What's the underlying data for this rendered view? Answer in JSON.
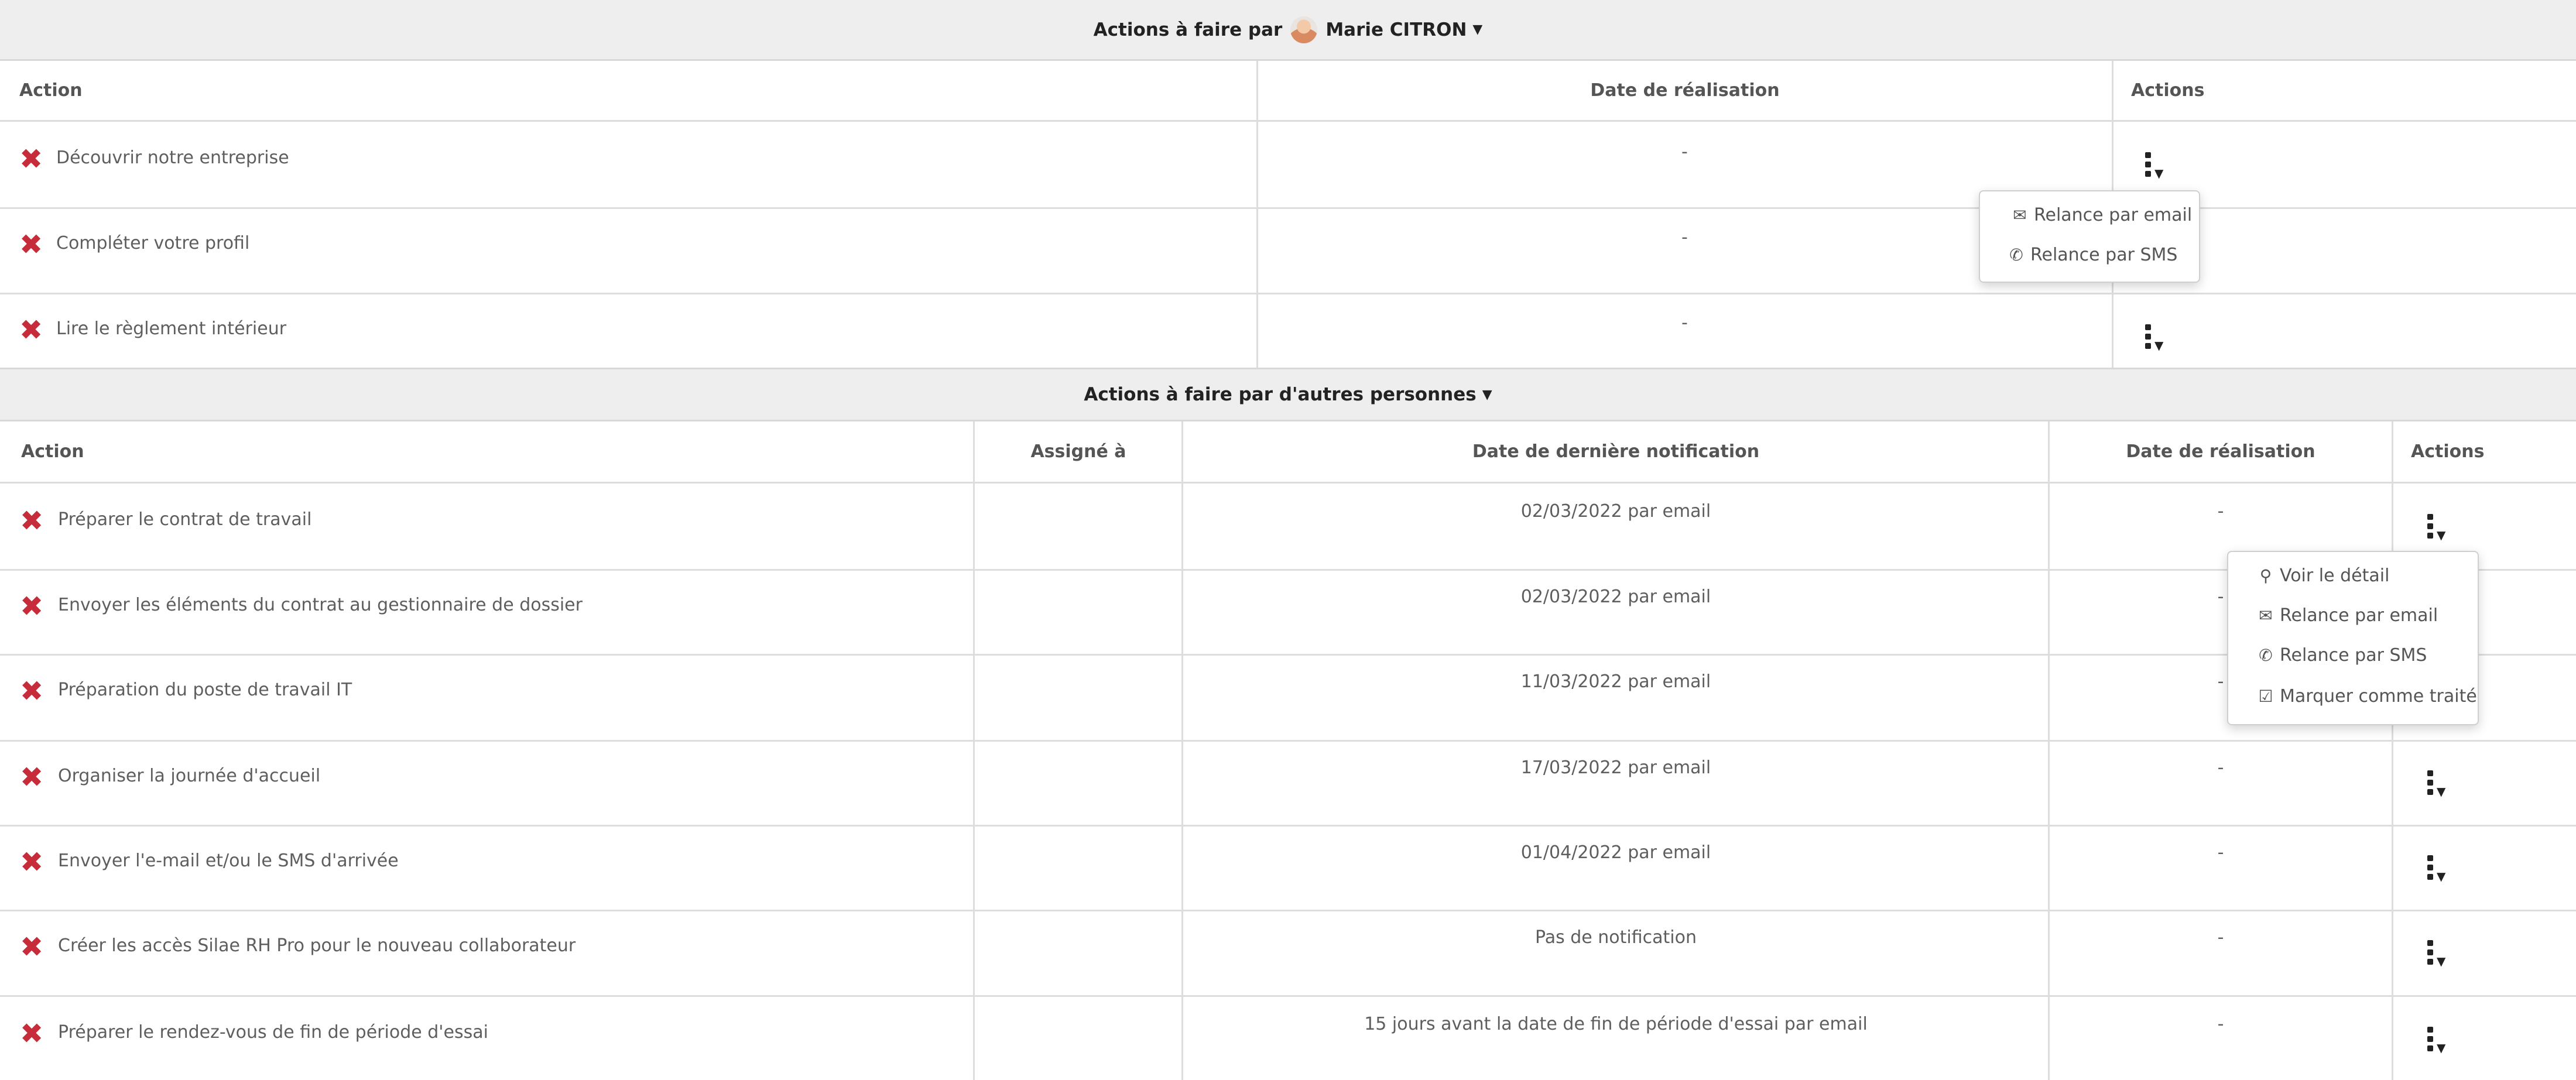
{
  "section1": {
    "title": "Actions à faire par",
    "user": "Marie CITRON",
    "headers": {
      "action": "Action",
      "date": "Date de réalisation",
      "actions": "Actions"
    },
    "rows": [
      {
        "action": "Découvrir notre entreprise",
        "date": "-"
      },
      {
        "action": "Compléter votre profil",
        "date": "-"
      },
      {
        "action": "Lire le règlement intérieur",
        "date": "-"
      }
    ],
    "menu": {
      "email": "Relance par email",
      "sms": "Relance par SMS"
    }
  },
  "section2": {
    "title": "Actions à faire par d'autres personnes",
    "headers": {
      "action": "Action",
      "assigned": "Assigné à",
      "notif": "Date de dernière notification",
      "date": "Date de réalisation",
      "actions": "Actions"
    },
    "rows": [
      {
        "action": "Préparer le contrat de travail",
        "assigned": "",
        "notif": "02/03/2022 par email",
        "date": "-"
      },
      {
        "action": "Envoyer les éléments du contrat au gestionnaire de dossier",
        "assigned": "",
        "notif": "02/03/2022 par email",
        "date": "-"
      },
      {
        "action": "Préparation du poste de travail IT",
        "assigned": "",
        "notif": "11/03/2022 par email",
        "date": "-"
      },
      {
        "action": "Organiser la journée d'accueil",
        "assigned": "",
        "notif": "17/03/2022 par email",
        "date": "-"
      },
      {
        "action": "Envoyer l'e-mail et/ou le SMS d'arrivée",
        "assigned": "",
        "notif": "01/04/2022 par email",
        "date": "-"
      },
      {
        "action": "Créer les accès Silae RH Pro pour le nouveau collaborateur",
        "assigned": "",
        "notif": "Pas de notification",
        "date": "-"
      },
      {
        "action": "Préparer le rendez-vous de fin de période d'essai",
        "assigned": "",
        "notif": "15 jours avant la date de fin de période d'essai par email",
        "date": "-"
      }
    ],
    "menu": {
      "detail": "Voir le détail",
      "email": "Relance par email",
      "sms": "Relance par SMS",
      "done": "Marquer comme traité"
    }
  },
  "icons": {
    "status": "close-icon",
    "menu": "kebab-icon",
    "detail": "search-icon",
    "email": "envelope-icon",
    "sms": "phone-icon",
    "done": "check-square-icon"
  },
  "colors": {
    "status_red": "#c62c3a",
    "header_bg": "#eeeeee",
    "border": "#dddddd"
  }
}
